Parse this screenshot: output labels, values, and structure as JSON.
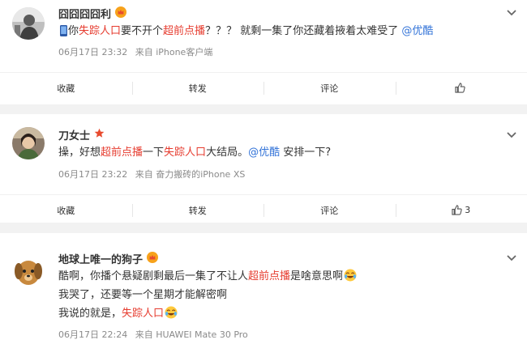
{
  "posts": [
    {
      "user": "囧囧囧囧利",
      "text_parts": [
        "",
        "你",
        "失踪人口",
        "要不开个",
        "超前点播",
        "？？？ 就剩一集了你还藏着掖着太难受了 ",
        "@优酷"
      ],
      "time": "06月17日 23:32",
      "source": "来自 iPhone客户端"
    },
    {
      "user": "刀女士",
      "text_parts": [
        "操，好想",
        "超前点播",
        "一下",
        "失踪人口",
        "大结局。",
        "@优酷",
        " 安排一下?"
      ],
      "time": "06月17日 23:22",
      "source": "来自 奋力搬砖的iPhone XS"
    },
    {
      "user": "地球上唯一的狗子",
      "lines": [
        [
          "酷啊，你播个悬疑剧剩最后一集了不让人",
          "超前点播",
          "是啥意思啊"
        ],
        [
          "我哭了，还要等一个星期才能解密啊"
        ],
        [
          "我说的就是，",
          "失踪人口"
        ]
      ],
      "time": "06月17日 22:24",
      "source": "来自 HUAWEI Mate 30 Pro"
    }
  ],
  "actions": {
    "favorite": "收藏",
    "repost": "转发",
    "comment": "评论",
    "like_count_2": "3"
  },
  "icons": [
    "chevron-down-icon",
    "thumbs-up-icon",
    "crown-badge-icon",
    "star-badge-icon",
    "laugh-cry-emoji-icon"
  ],
  "colors": {
    "highlight": "#e63b2e",
    "mention": "#eb7350",
    "mention_blue": "#3273d8",
    "meta": "#8a8a8a"
  }
}
